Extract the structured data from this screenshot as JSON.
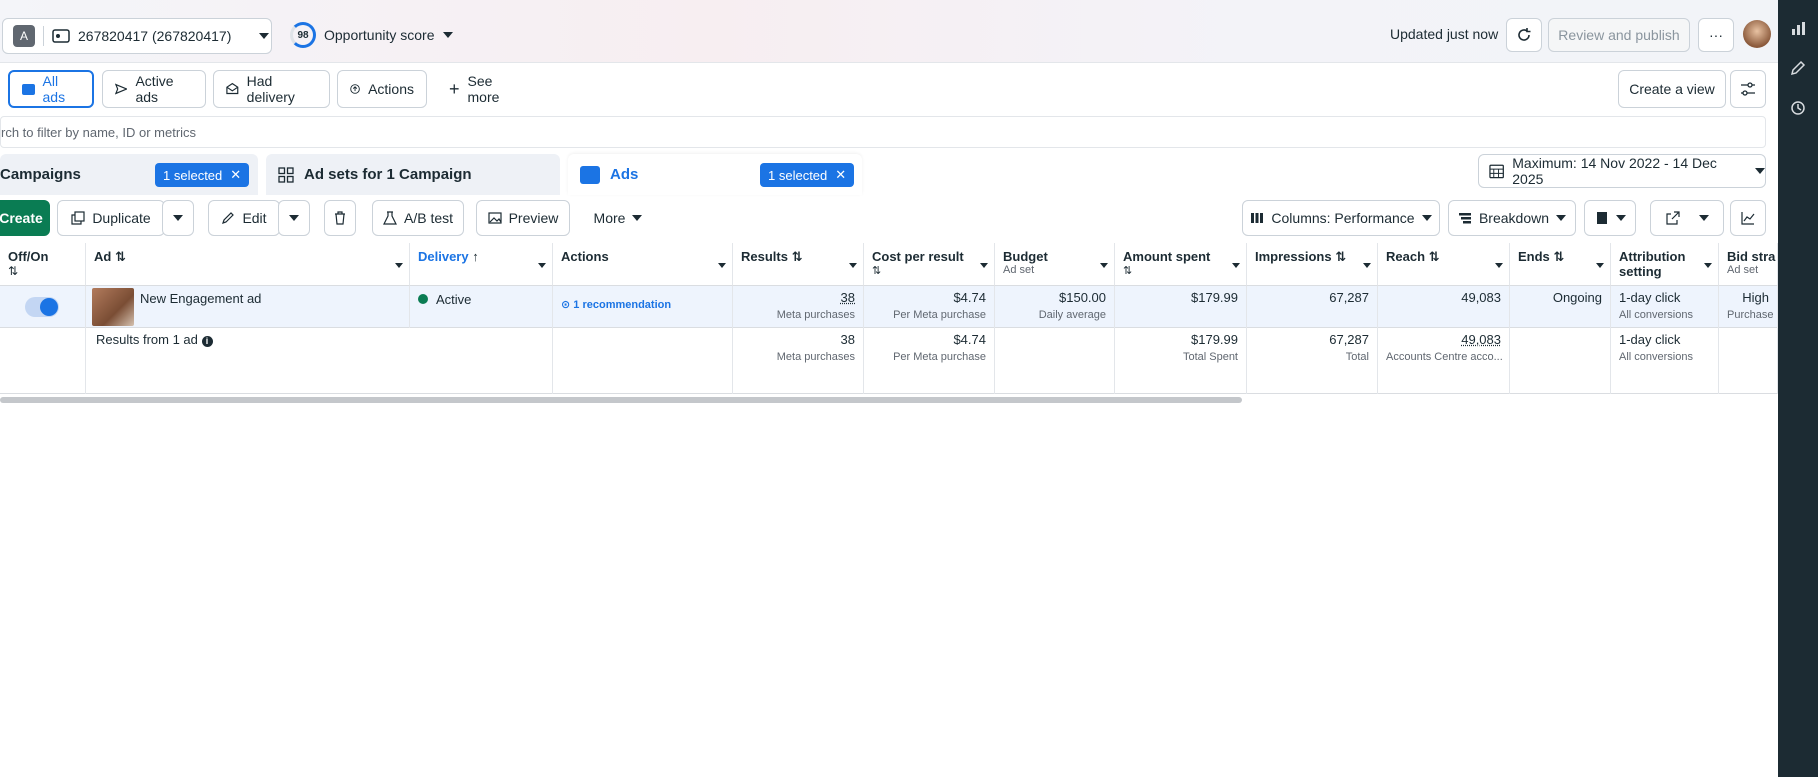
{
  "topbar": {
    "account_initial": "A",
    "account_label": "267820417 (267820417)",
    "opportunity_score": "98",
    "opportunity_label": "Opportunity score",
    "updated": "Updated just now",
    "review_publish": "Review and publish",
    "more": "···"
  },
  "filters": {
    "all_ads": "All ads",
    "active_ads": "Active ads",
    "had_delivery": "Had delivery",
    "actions": "Actions",
    "see_more": "See more",
    "create_view": "Create a view",
    "search_placeholder": "rch to filter by name, ID or metrics"
  },
  "tabs": {
    "campaigns": "Campaigns",
    "campaigns_selected": "1 selected",
    "adsets": "Ad sets for 1 Campaign",
    "ads": "Ads",
    "ads_selected": "1 selected",
    "date_range": "Maximum: 14 Nov 2022 - 14 Dec 2025"
  },
  "toolbar": {
    "create": "Create",
    "duplicate": "Duplicate",
    "edit": "Edit",
    "ab_test": "A/B test",
    "preview": "Preview",
    "more": "More",
    "columns": "Columns: Performance",
    "breakdown": "Breakdown"
  },
  "table": {
    "headers": {
      "offon": "Off/On",
      "ad": "Ad",
      "delivery": "Delivery",
      "actions": "Actions",
      "results": "Results",
      "cpr": "Cost per result",
      "budget": "Budget",
      "budget_sub": "Ad set",
      "amount": "Amount spent",
      "impressions": "Impressions",
      "reach": "Reach",
      "ends": "Ends",
      "attribution": "Attribution setting",
      "bid": "Bid stra",
      "bid_sub": "Ad set"
    },
    "row": {
      "ad_name": "New Engagement ad",
      "delivery": "Active",
      "actions": "1 recommendation",
      "results": "38",
      "results_sub": "Meta purchases",
      "cpr": "$4.74",
      "cpr_sub": "Per Meta purchase",
      "budget": "$150.00",
      "budget_sub": "Daily average",
      "amount": "$179.99",
      "impressions": "67,287",
      "reach": "49,083",
      "ends": "Ongoing",
      "attribution": "1-day click",
      "attribution_sub": "All conversions",
      "bid": "High",
      "bid_sub": "Purchase"
    },
    "summary": {
      "label": "Results from 1 ad",
      "results": "38",
      "results_sub": "Meta purchases",
      "cpr": "$4.74",
      "cpr_sub": "Per Meta purchase",
      "amount": "$179.99",
      "amount_sub": "Total Spent",
      "impressions": "67,287",
      "impressions_sub": "Total",
      "reach": "49,083",
      "reach_sub": "Accounts Centre acco...",
      "attribution": "1-day click",
      "attribution_sub": "All conversions"
    }
  }
}
